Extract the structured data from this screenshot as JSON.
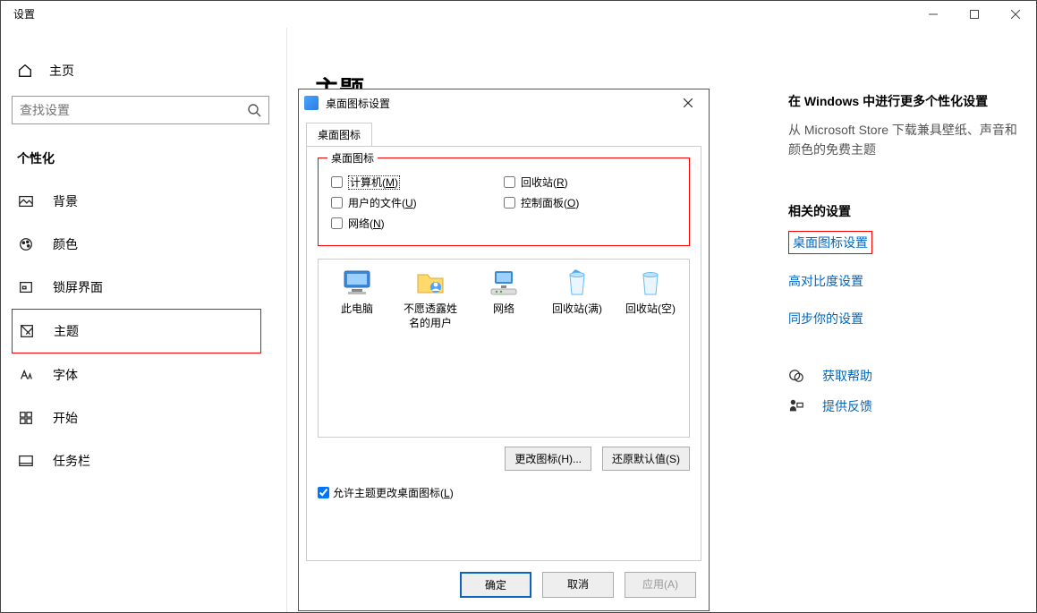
{
  "window": {
    "title": "设置",
    "controls": {
      "min": "minimize",
      "max": "maximize",
      "close": "close"
    }
  },
  "sidebar": {
    "home": "主页",
    "search_placeholder": "查找设置",
    "section": "个性化",
    "items": [
      {
        "icon": "background",
        "label": "背景"
      },
      {
        "icon": "colors",
        "label": "颜色"
      },
      {
        "icon": "lockscreen",
        "label": "锁屏界面"
      },
      {
        "icon": "themes",
        "label": "主题",
        "selected": true
      },
      {
        "icon": "fonts",
        "label": "字体"
      },
      {
        "icon": "start",
        "label": "开始"
      },
      {
        "icon": "taskbar",
        "label": "任务栏"
      }
    ]
  },
  "main": {
    "title": "主题"
  },
  "right": {
    "heading1": "在 Windows 中进行更多个性化设置",
    "desc": "从 Microsoft Store 下载兼具壁纸、声音和颜色的免费主题",
    "heading2": "相关的设置",
    "links": [
      {
        "label": "桌面图标设置",
        "boxed": true
      },
      {
        "label": "高对比度设置"
      },
      {
        "label": "同步你的设置"
      }
    ],
    "help": [
      {
        "icon": "help",
        "label": "获取帮助"
      },
      {
        "icon": "feedback",
        "label": "提供反馈"
      }
    ]
  },
  "dialog": {
    "title": "桌面图标设置",
    "tab": "桌面图标",
    "group_legend": "桌面图标",
    "checks_left": [
      {
        "pre": "计算机(",
        "u": "M",
        "post": ")",
        "selected": true
      },
      {
        "pre": "用户的文件(",
        "u": "U",
        "post": ")"
      },
      {
        "pre": "网络(",
        "u": "N",
        "post": ")"
      }
    ],
    "checks_right": [
      {
        "pre": "回收站(",
        "u": "R",
        "post": ")"
      },
      {
        "pre": "控制面板(",
        "u": "O",
        "post": ")"
      }
    ],
    "icons": [
      {
        "name": "此电脑",
        "type": "pc"
      },
      {
        "name": "不愿透露姓名的用户",
        "type": "folder"
      },
      {
        "name": "网络",
        "type": "network"
      },
      {
        "name": "回收站(满)",
        "type": "bin-full"
      },
      {
        "name": "回收站(空)",
        "type": "bin-empty"
      }
    ],
    "btn_change": "更改图标(H)...",
    "btn_default": "还原默认值(S)",
    "allow_pre": "允许主题更改桌面图标(",
    "allow_u": "L",
    "allow_post": ")",
    "allow_checked": true,
    "ok": "确定",
    "cancel": "取消",
    "apply": "应用(A)"
  }
}
